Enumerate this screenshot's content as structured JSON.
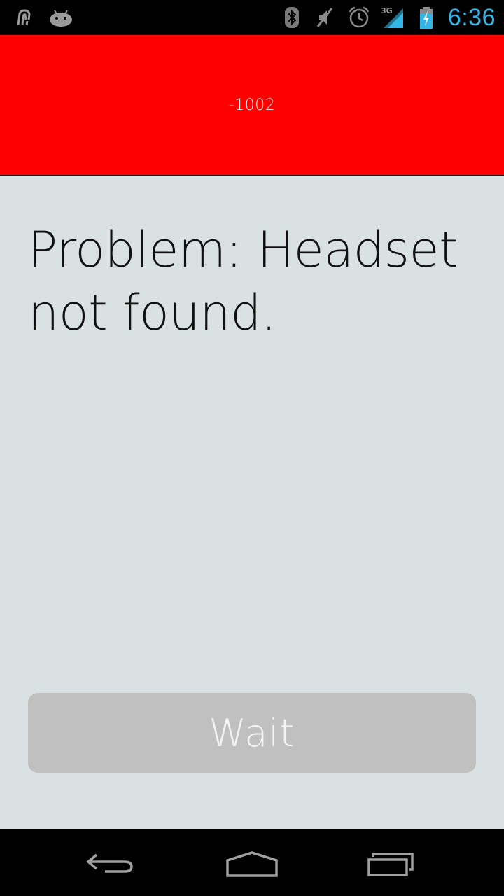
{
  "status_bar": {
    "time": "6:36",
    "network": "3G",
    "left_icons": [
      "usb-debug-icon",
      "android-icon"
    ],
    "right_icons": [
      "bluetooth-icon",
      "mute-icon",
      "alarm-icon",
      "signal-icon",
      "battery-charging-icon"
    ],
    "clock_color": "#33b5e5"
  },
  "header": {
    "code": "-1002",
    "background_color": "#ff0000"
  },
  "message": {
    "text": "Problem: Headset not found."
  },
  "action": {
    "wait_label": "Wait"
  },
  "nav_bar": {
    "buttons": [
      "back-icon",
      "home-icon",
      "recent-apps-icon"
    ]
  }
}
